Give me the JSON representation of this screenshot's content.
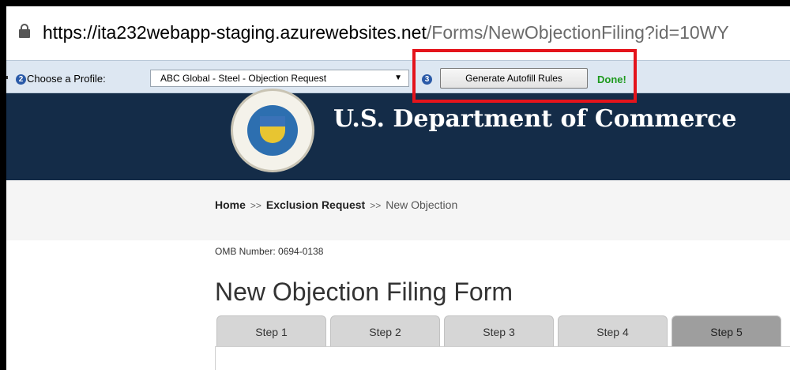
{
  "browser": {
    "url_host": "https://ita232webapp-staging.azurewebsites.net",
    "url_path": "/Forms/NewObjectionFiling?id=10WY"
  },
  "toolbar": {
    "step2_num": "2",
    "profile_label": "Choose a Profile:",
    "profile_value": "ABC Global - Steel - Objection Request",
    "step3_num": "3",
    "generate_button": "Generate Autofill Rules",
    "status": "Done!"
  },
  "header": {
    "agency": "U.S. Department of Commerce"
  },
  "breadcrumb": {
    "home": "Home",
    "sep1": ">>",
    "exclusion": "Exclusion Request",
    "sep2": ">>",
    "current": "New Objection"
  },
  "omb": "OMB Number: 0694-0138",
  "form_title": "New Objection Filing Form",
  "steps": [
    "Step 1",
    "Step 2",
    "Step 3",
    "Step 4",
    "Step 5"
  ],
  "colors": {
    "header_bg": "#142c48",
    "highlight": "#e4141c",
    "done": "#1e9a1e"
  }
}
